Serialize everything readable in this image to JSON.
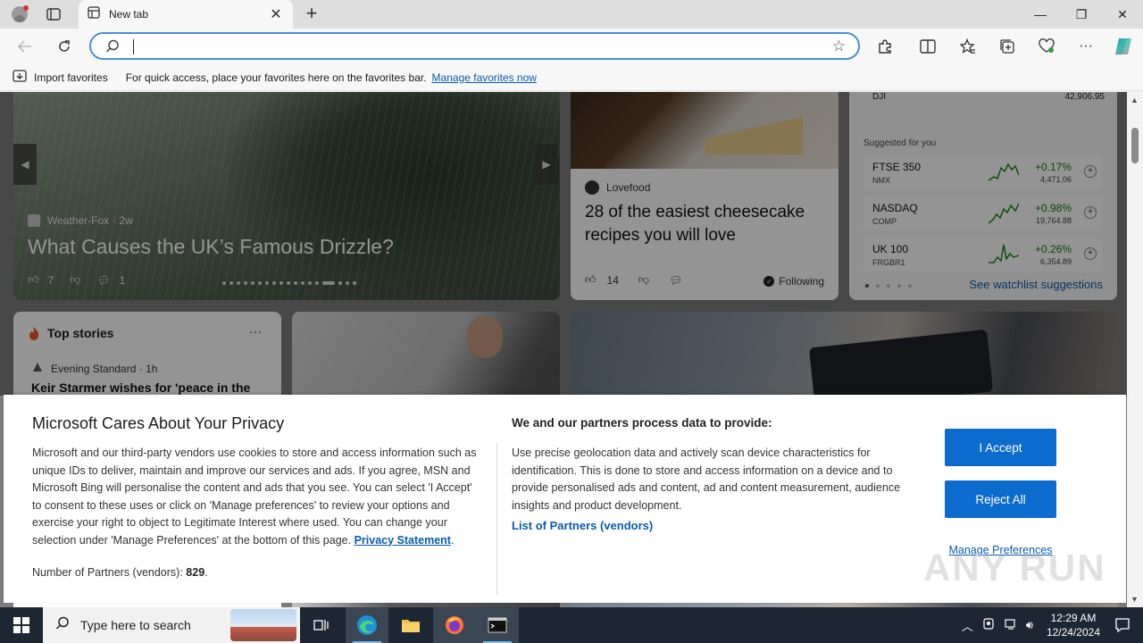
{
  "browser": {
    "tab_title": "New tab",
    "address_value": "",
    "address_placeholder": ""
  },
  "favorites_bar": {
    "import_label": "Import favorites",
    "message": "For quick access, place your favorites here on the favorites bar.",
    "manage_link": "Manage favorites now"
  },
  "feed": {
    "hero": {
      "source": "Weather-Fox",
      "age": "· 2w",
      "headline": "What Causes the UK’s Famous Drizzle?",
      "likes": "7",
      "comments": "1"
    },
    "cheesecake": {
      "source": "Lovefood",
      "headline": "28 of the easiest cheesecake recipes you will love",
      "likes": "14",
      "following": "Following"
    },
    "markets": {
      "dji_name": "DJI",
      "dji_price": "42,906.95",
      "suggested_label": "Suggested for you",
      "rows": [
        {
          "name": "FTSE 350",
          "sub": "NMX",
          "change": "+0.17%",
          "price": "4,471.06"
        },
        {
          "name": "NASDAQ",
          "sub": "COMP",
          "change": "+0.98%",
          "price": "19,764.88"
        },
        {
          "name": "UK 100",
          "sub": "FRGBR1",
          "change": "+0.26%",
          "price": "6,354.89"
        }
      ],
      "watchlist_link": "See watchlist suggestions",
      "positive_color": "#107c10"
    },
    "top_stories": {
      "title": "Top stories",
      "more": "···",
      "source": "Evening Standard · 1h",
      "headline": "Keir Starmer wishes for 'peace in the"
    }
  },
  "privacy": {
    "title": "Microsoft Cares About Your Privacy",
    "body": "Microsoft and our third-party vendors use cookies to store and access information such as unique IDs to deliver, maintain and improve our services and ads. If you agree, MSN and Microsoft Bing will personalise the content and ads that you see. You can select 'I Accept' to consent to these uses or click on 'Manage preferences' to review your options and exercise your right to object to Legitimate Interest where used.  You can change your selection under 'Manage Preferences' at the bottom of this page.",
    "privacy_link": "Privacy Statement",
    "partners_label": "Number of Partners (vendors):",
    "partners_count": "829",
    "sub_title": "We and our partners process data to provide:",
    "body2": "Use precise geolocation data and actively scan device characteristics for identification. This is done to store and access information on a device and to provide personalised ads and content, ad and content measurement, audience insights and product development.",
    "list_link": "List of Partners (vendors)",
    "accept": "I Accept",
    "reject": "Reject All",
    "manage": "Manage Preferences",
    "button_color": "#0b6ccd"
  },
  "watermark": "ANY RUN",
  "taskbar": {
    "search_placeholder": "Type here to search",
    "time": "12:29 AM",
    "date": "12/24/2024"
  }
}
